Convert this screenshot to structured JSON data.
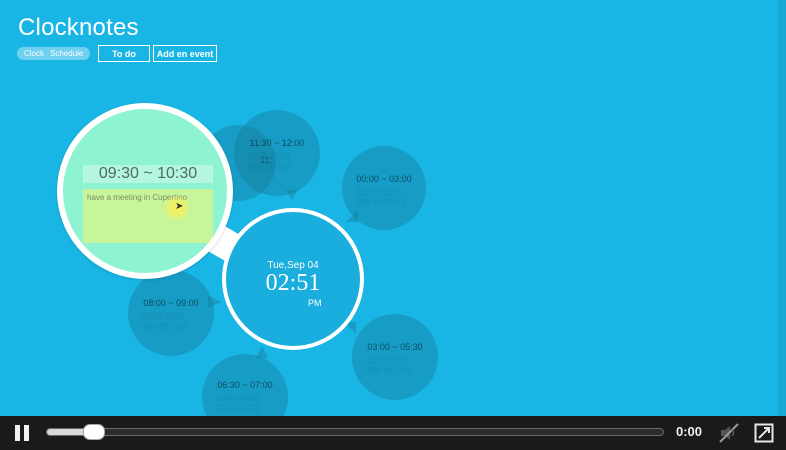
{
  "app": {
    "title": "Clocknotes"
  },
  "view_switch": {
    "items": [
      "Clock",
      "Schedule"
    ]
  },
  "buttons": {
    "todo": "To do",
    "add_event": "Add en event"
  },
  "clock": {
    "date": "Tue,Sep 04",
    "time": "02:51",
    "ampm": "PM"
  },
  "selected_event": {
    "time": "09:30 ~ 10:30",
    "note": "have a meeting in Cupertino"
  },
  "bubbles": [
    {
      "id": "b1",
      "time": "11:30 ~ 12:00"
    },
    {
      "id": "b2",
      "time": "00:00 ~ 03:00"
    },
    {
      "id": "b3",
      "time": "08:00 ~ 09:00"
    },
    {
      "id": "b4",
      "time": "03:00 ~ 05:30"
    },
    {
      "id": "b5",
      "time": "06:30 ~ 07:00"
    },
    {
      "id": "b6",
      "time": "11:"
    }
  ],
  "player": {
    "time": "0:00",
    "progress": 0.075
  },
  "colors": {
    "background": "#19b6e5",
    "highlight": "#8ef3d0",
    "control_bar": "#1a1a1a"
  },
  "icons": {
    "play_state": "pause-icon",
    "volume": "mute-icon",
    "fullscreen": "fullscreen-icon"
  }
}
